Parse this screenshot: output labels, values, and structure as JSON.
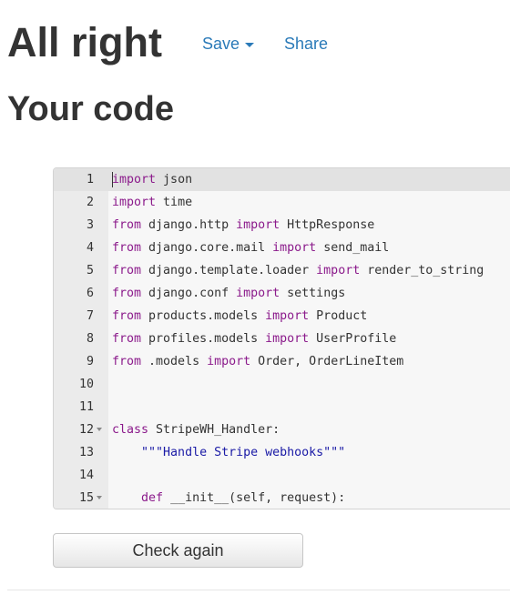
{
  "header": {
    "title": "All right",
    "save_label": "Save",
    "share_label": "Share"
  },
  "section": {
    "title": "Your code"
  },
  "editor": {
    "lines": [
      {
        "num": "1",
        "tokens": [
          {
            "t": "import",
            "c": "kw"
          },
          {
            "t": " json"
          }
        ]
      },
      {
        "num": "2",
        "tokens": [
          {
            "t": "import",
            "c": "kw"
          },
          {
            "t": " time"
          }
        ]
      },
      {
        "num": "3",
        "tokens": [
          {
            "t": "from",
            "c": "kw"
          },
          {
            "t": " django.http "
          },
          {
            "t": "import",
            "c": "kw"
          },
          {
            "t": " HttpResponse"
          }
        ]
      },
      {
        "num": "4",
        "tokens": [
          {
            "t": "from",
            "c": "kw"
          },
          {
            "t": " django.core.mail "
          },
          {
            "t": "import",
            "c": "kw"
          },
          {
            "t": " send_mail"
          }
        ]
      },
      {
        "num": "5",
        "tokens": [
          {
            "t": "from",
            "c": "kw"
          },
          {
            "t": " django.template.loader "
          },
          {
            "t": "import",
            "c": "kw"
          },
          {
            "t": " render_to_string"
          }
        ]
      },
      {
        "num": "6",
        "tokens": [
          {
            "t": "from",
            "c": "kw"
          },
          {
            "t": " django.conf "
          },
          {
            "t": "import",
            "c": "kw"
          },
          {
            "t": " settings"
          }
        ]
      },
      {
        "num": "7",
        "tokens": [
          {
            "t": "from",
            "c": "kw"
          },
          {
            "t": " products.models "
          },
          {
            "t": "import",
            "c": "kw"
          },
          {
            "t": " Product"
          }
        ]
      },
      {
        "num": "8",
        "tokens": [
          {
            "t": "from",
            "c": "kw"
          },
          {
            "t": " profiles.models "
          },
          {
            "t": "import",
            "c": "kw"
          },
          {
            "t": " UserProfile"
          }
        ]
      },
      {
        "num": "9",
        "tokens": [
          {
            "t": "from",
            "c": "kw"
          },
          {
            "t": " .models "
          },
          {
            "t": "import",
            "c": "kw"
          },
          {
            "t": " Order, OrderLineItem"
          }
        ]
      },
      {
        "num": "10",
        "tokens": []
      },
      {
        "num": "11",
        "tokens": []
      },
      {
        "num": "12",
        "fold": true,
        "tokens": [
          {
            "t": "class",
            "c": "kw"
          },
          {
            "t": " StripeWH_Handler:"
          }
        ]
      },
      {
        "num": "13",
        "tokens": [
          {
            "t": "    "
          },
          {
            "t": "\"\"\"Handle Stripe webhooks\"\"\"",
            "c": "str"
          }
        ]
      },
      {
        "num": "14",
        "tokens": []
      },
      {
        "num": "15",
        "fold": true,
        "tokens": [
          {
            "t": "    "
          },
          {
            "t": "def",
            "c": "kw"
          },
          {
            "t": " __init__(self, request):"
          }
        ]
      }
    ]
  },
  "actions": {
    "check_again_label": "Check again"
  }
}
